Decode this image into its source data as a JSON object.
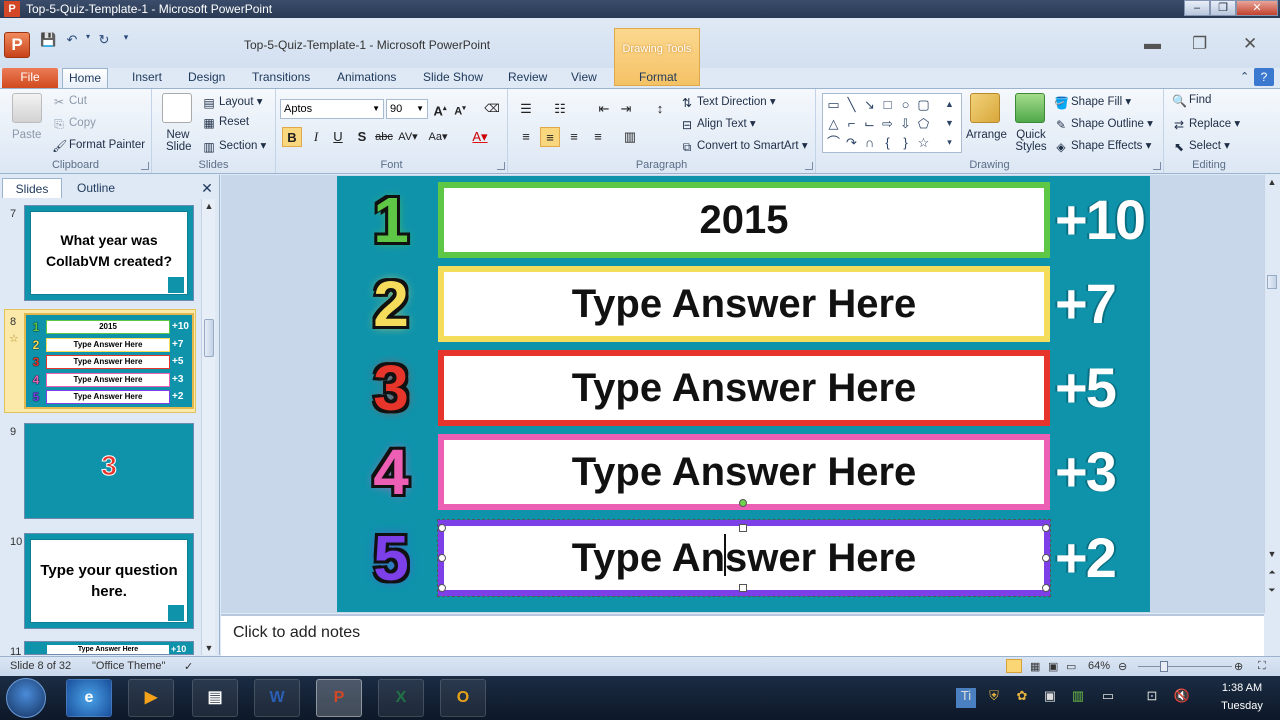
{
  "window": {
    "title": "Top-5-Quiz-Template-1 - Microsoft PowerPoint",
    "doc_title": "Top-5-Quiz-Template-1  -  Microsoft PowerPoint",
    "contextual_tab": "Drawing Tools"
  },
  "tabs": [
    "File",
    "Home",
    "Insert",
    "Design",
    "Transitions",
    "Animations",
    "Slide Show",
    "Review",
    "View",
    "Format"
  ],
  "ribbon": {
    "clipboard": {
      "paste": "Paste",
      "cut": "Cut",
      "copy": "Copy",
      "format_painter": "Format Painter",
      "label": "Clipboard"
    },
    "slides": {
      "new_slide": "New Slide",
      "layout": "Layout",
      "reset": "Reset",
      "section": "Section",
      "label": "Slides"
    },
    "font": {
      "name": "Aptos",
      "size": "90",
      "label": "Font"
    },
    "paragraph": {
      "text_direction": "Text Direction",
      "align_text": "Align Text",
      "convert_smartart": "Convert to SmartArt",
      "label": "Paragraph"
    },
    "drawing": {
      "arrange": "Arrange",
      "quick_styles": "Quick Styles",
      "shape_fill": "Shape Fill",
      "shape_outline": "Shape Outline",
      "shape_effects": "Shape Effects",
      "label": "Drawing"
    },
    "editing": {
      "find": "Find",
      "replace": "Replace",
      "select": "Select",
      "label": "Editing"
    }
  },
  "panel": {
    "tabs": [
      "Slides",
      "Outline"
    ],
    "thumbs": [
      {
        "num": "7",
        "text": "What year was CollabVM created?"
      },
      {
        "num": "8",
        "rows": [
          "2015",
          "Type Answer Here",
          "Type Answer Here",
          "Type Answer Here",
          "Type Answer Here"
        ],
        "nums": [
          "1",
          "2",
          "3",
          "4",
          "5"
        ],
        "points": [
          "+10",
          "+7",
          "+5",
          "+3",
          "+2"
        ]
      },
      {
        "num": "9",
        "text": "3"
      },
      {
        "num": "10",
        "text": "Type your question here."
      },
      {
        "num": "11",
        "text": "Type Answer Here",
        "point": "+10"
      }
    ]
  },
  "slide": {
    "rows": [
      {
        "num": "1",
        "answer": "2015",
        "points": "+10",
        "color": "#5ec745"
      },
      {
        "num": "2",
        "answer": "Type Answer Here",
        "points": "+7",
        "color": "#f5dd5b"
      },
      {
        "num": "3",
        "answer": "Type Answer Here",
        "points": "+5",
        "color": "#e8352b"
      },
      {
        "num": "4",
        "answer": "Type Answer Here",
        "points": "+3",
        "color": "#ec5fb5"
      },
      {
        "num": "5",
        "answer": "Type Answer Here",
        "points": "+2",
        "color": "#7c3fe8"
      }
    ]
  },
  "notes": "Click to add notes",
  "status": {
    "slide": "Slide 8 of 32",
    "theme": "\"Office Theme\"",
    "zoom": "64%"
  },
  "taskbar": {
    "time": "1:38 AM",
    "day": "Tuesday"
  }
}
